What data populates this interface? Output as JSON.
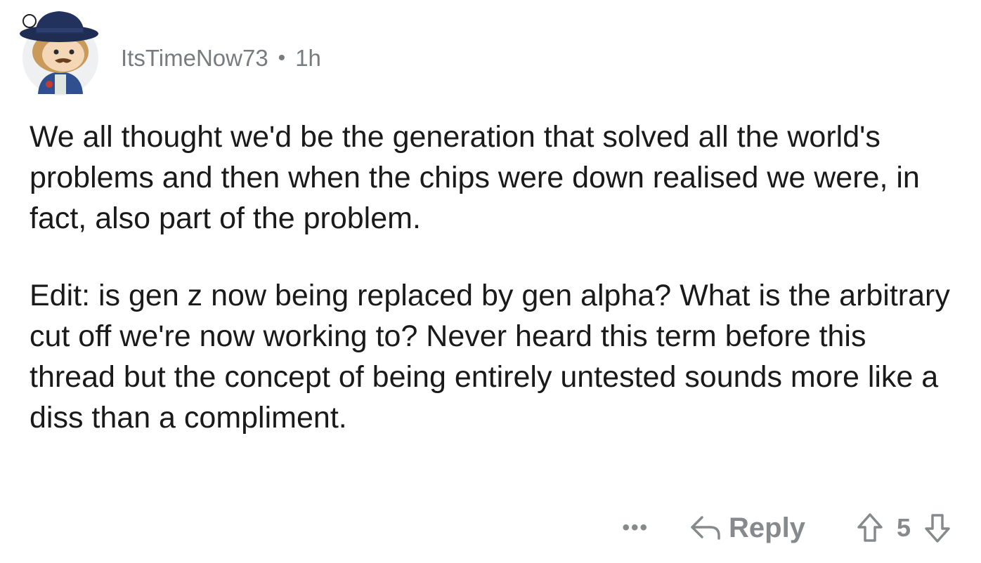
{
  "comment": {
    "author": "ItsTimeNow73",
    "separator": "•",
    "time": "1h",
    "paragraphs": [
      "We all thought we'd be the generation that solved all the world's problems and then when the chips were down realised we were, in fact, also part of the problem.",
      "Edit: is gen z now being replaced by gen alpha? What is the arbitrary cut off we're now working to? Never heard this term before this thread but the concept of being entirely untested sounds more like a diss than a compliment."
    ]
  },
  "actions": {
    "more_label": "•••",
    "reply_label": "Reply",
    "vote_count": "5"
  },
  "icons": {
    "avatar": "snoo-avatar-hat",
    "reply": "reply-arrow-icon",
    "upvote": "upvote-arrow-icon",
    "downvote": "downvote-arrow-icon"
  },
  "colors": {
    "text": "#1a1a1b",
    "meta": "#787c7e",
    "action": "#878a8c"
  }
}
